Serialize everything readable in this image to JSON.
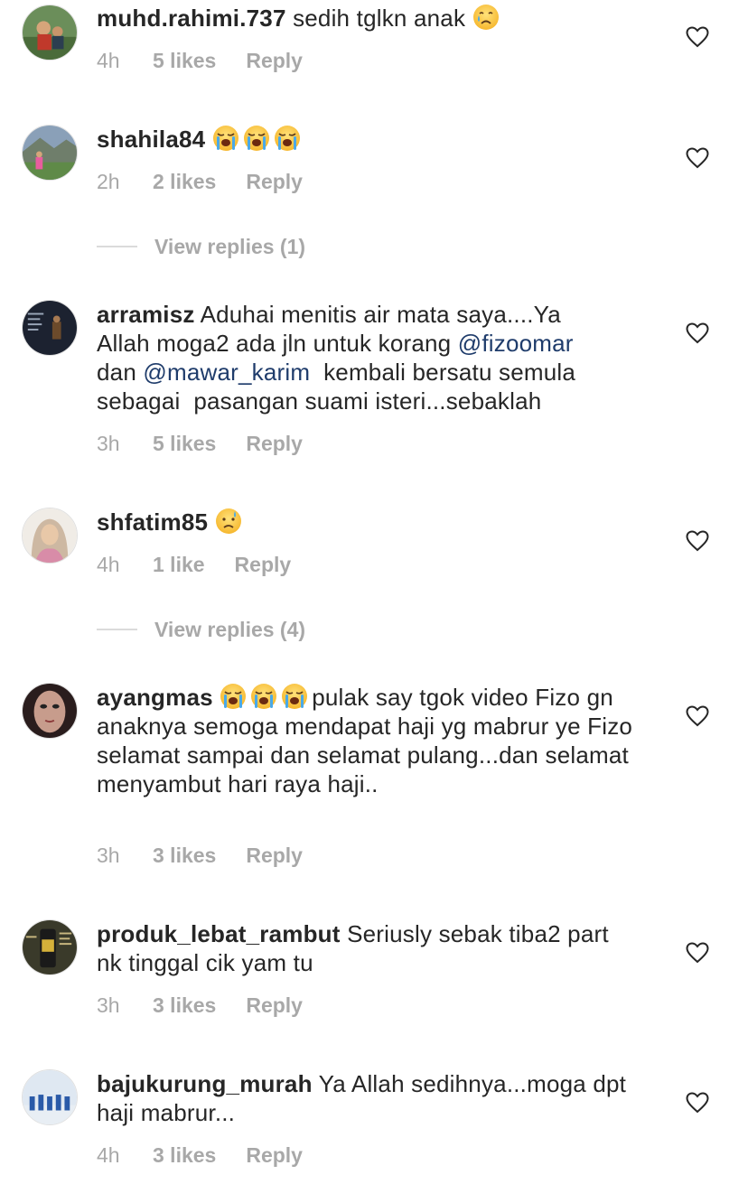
{
  "comments": [
    {
      "username": "muhd.rahimi.737",
      "text": "sedih tglkn anak",
      "emojis": [
        "crying-face"
      ],
      "time": "4h",
      "likes": "5 likes",
      "reply": "Reply"
    },
    {
      "username": "shahila84",
      "text": "",
      "emojis": [
        "loudly-crying-face",
        "loudly-crying-face",
        "loudly-crying-face"
      ],
      "time": "2h",
      "likes": "2 likes",
      "reply": "Reply",
      "view_replies": "View replies (1)"
    },
    {
      "username": "arramisz",
      "text_lines": [
        "Aduhai menitis air mata saya....Ya",
        "Allah moga2 ada jln untuk korang ",
        "dan ",
        "sebagai  pasangan suami isteri...sebaklah"
      ],
      "mention1": "@fizoomar",
      "mention2": "@mawar_karim",
      "after_mention2": "  kembali bersatu semula",
      "time": "3h",
      "likes": "5 likes",
      "reply": "Reply"
    },
    {
      "username": "shfatim85",
      "text": "",
      "emojis": [
        "sad-sweat-face"
      ],
      "time": "4h",
      "likes": "1 like",
      "reply": "Reply",
      "view_replies": "View replies (4)"
    },
    {
      "username": "ayangmas",
      "text": "pulak say tgok video Fizo gn anaknya semoga mendapat haji yg mabrur ye Fizo selamat sampai dan selamat pulang...dan selamat menyambut hari raya haji..",
      "emojis": [
        "loudly-crying-face",
        "loudly-crying-face",
        "loudly-crying-face"
      ],
      "time": "3h",
      "likes": "3 likes",
      "reply": "Reply"
    },
    {
      "username": "produk_lebat_rambut",
      "text": "Seriusly sebak tiba2 part nk tinggal cik yam tu",
      "time": "3h",
      "likes": "3 likes",
      "reply": "Reply"
    },
    {
      "username": "bajukurung_murah",
      "text": "Ya Allah sedihnya...moga dpt haji mabrur...",
      "time": "4h",
      "likes": "3 likes",
      "reply": "Reply"
    }
  ],
  "colors": {
    "meta": "#a8a8a8",
    "mention": "#1f3c6b",
    "text": "#262626"
  },
  "icons": {
    "like": "heart-outline-icon"
  }
}
